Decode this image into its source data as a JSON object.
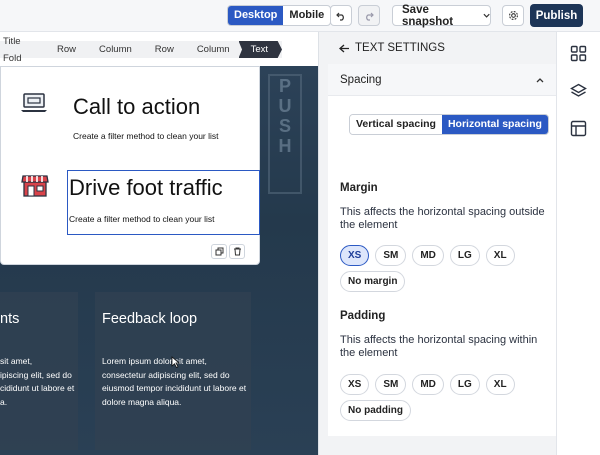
{
  "toolbar": {
    "view_modes": [
      "Desktop",
      "Mobile"
    ],
    "active_view": "Desktop",
    "save_snapshot_label": "Save snapshot",
    "publish_label": "Publish"
  },
  "breadcrumb": [
    "Title Fold",
    "Row",
    "Column",
    "Row",
    "Column",
    "Text"
  ],
  "canvas": {
    "blocks": [
      {
        "heading": "Call to action",
        "body": "Create a filter method to clean your list"
      },
      {
        "heading": "Drive foot traffic",
        "body": "Create a filter method to clean your list"
      }
    ],
    "tiles": [
      {
        "title": "nts",
        "body": "sit amet,\nipiscing elit, sed do\ncididunt ut labore et\na."
      },
      {
        "title": "Feedback loop",
        "body": "Lorem ipsum dolor sit amet,\nconsectetur adipiscing elit, sed do\neiusmod tempor incididunt ut labore et\ndolore magna aliqua."
      }
    ],
    "bg_sign_letters": [
      "P",
      "U",
      "S",
      "H"
    ]
  },
  "panel": {
    "title": "TEXT SETTINGS",
    "section": "Spacing",
    "direction_options": [
      "Vertical spacing",
      "Horizontal spacing"
    ],
    "active_direction": "Horizontal spacing",
    "margin": {
      "title": "Margin",
      "description": "This affects the horizontal spacing outside the element",
      "sizes": [
        "XS",
        "SM",
        "MD",
        "LG",
        "XL"
      ],
      "selected": "XS",
      "none_label": "No margin"
    },
    "padding": {
      "title": "Padding",
      "description": "This affects the horizontal spacing within the element",
      "sizes": [
        "XS",
        "SM",
        "MD",
        "LG",
        "XL"
      ],
      "selected": "",
      "none_label": "No padding"
    }
  },
  "colors": {
    "accent": "#2b59c3",
    "publish": "#1d3557",
    "canvas_bg": "#2c4258",
    "icon_red": "#d9434a"
  },
  "icons": {
    "undo": "undo-icon",
    "redo": "redo-icon",
    "settings": "gear-icon",
    "back": "arrow-left-icon",
    "collapse": "chevron-up-icon",
    "rail": [
      "grid-icon",
      "layers-icon",
      "layout-icon"
    ]
  }
}
